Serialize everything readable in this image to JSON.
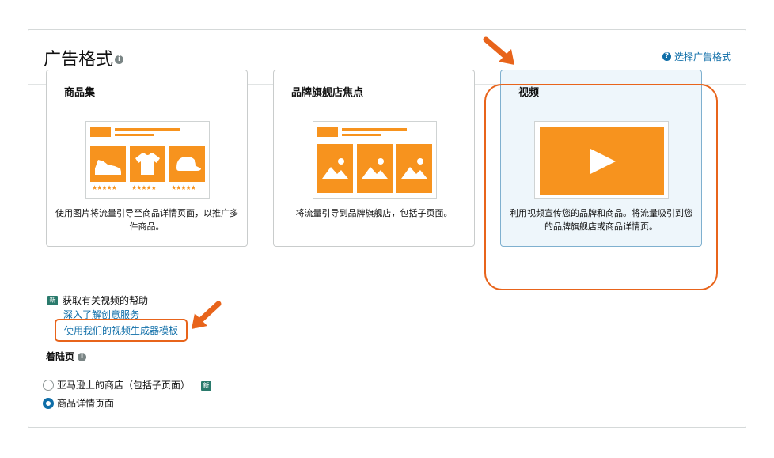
{
  "header": {
    "title": "广告格式",
    "info_icon": "info-icon",
    "help_link": "选择广告格式",
    "help_icon": "question-icon"
  },
  "cards": [
    {
      "title": "商品集",
      "description": "使用图片将流量引导至商品详情页面，以推广多件商品。",
      "selected": false,
      "stars": [
        "★★★★★",
        "★★★★★",
        "★★★★★"
      ]
    },
    {
      "title": "品牌旗舰店焦点",
      "description": "将流量引导到品牌旗舰店，包括子页面。",
      "selected": false
    },
    {
      "title": "视频",
      "description": "利用视频宣传您的品牌和商品。将流量吸引到您的品牌旗舰店或商品详情页。",
      "selected": true
    }
  ],
  "help_section": {
    "badge": "新",
    "title": "获取有关视频的帮助",
    "links": [
      "深入了解创意服务",
      "使用我们的视频生成器模板"
    ]
  },
  "landing_page": {
    "title": "着陆页",
    "options": [
      {
        "label": "亚马逊上的商店（包括子页面）",
        "badge": "新",
        "selected": false
      },
      {
        "label": "商品详情页面",
        "selected": true
      }
    ]
  },
  "colors": {
    "accent": "#f7931e",
    "annotation": "#e8641b",
    "link": "#0f6ea8",
    "selected_card_bg": "#eef6fb",
    "badge": "#2a7a6c"
  }
}
